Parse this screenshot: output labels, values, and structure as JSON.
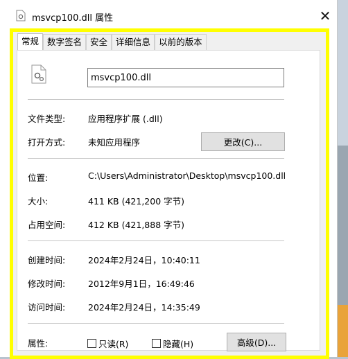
{
  "window": {
    "title": "msvcp100.dll 属性",
    "close_symbol": "✕"
  },
  "tabs": [
    "常规",
    "数字签名",
    "安全",
    "详细信息",
    "以前的版本"
  ],
  "file": {
    "name": "msvcp100.dll"
  },
  "info": {
    "type_label": "文件类型:",
    "type_value": "应用程序扩展 (.dll)",
    "open_label": "打开方式:",
    "open_value": "未知应用程序",
    "change_button": "更改(C)...",
    "location_label": "位置:",
    "location_value": "C:\\Users\\Administrator\\Desktop\\msvcp100.dll",
    "size_label": "大小:",
    "size_value": "411 KB (421,200 字节)",
    "disk_label": "占用空间:",
    "disk_value": "412 KB (421,888 字节)",
    "created_label": "创建时间:",
    "created_value": "2024年2月24日，10:40:11",
    "modified_label": "修改时间:",
    "modified_value": "2012年9月1日，16:49:46",
    "accessed_label": "访问时间:",
    "accessed_value": "2024年2月24日，14:35:49",
    "attributes_label": "属性:",
    "readonly_label": "只读(R)",
    "hidden_label": "隐藏(H)",
    "advanced_button": "高级(D)..."
  },
  "colors": {
    "highlight": "#ffff00",
    "background": "#f0f0f0"
  },
  "icons": {
    "title_icon": "dll-file-icon",
    "file_icon": "gear-file-icon"
  }
}
